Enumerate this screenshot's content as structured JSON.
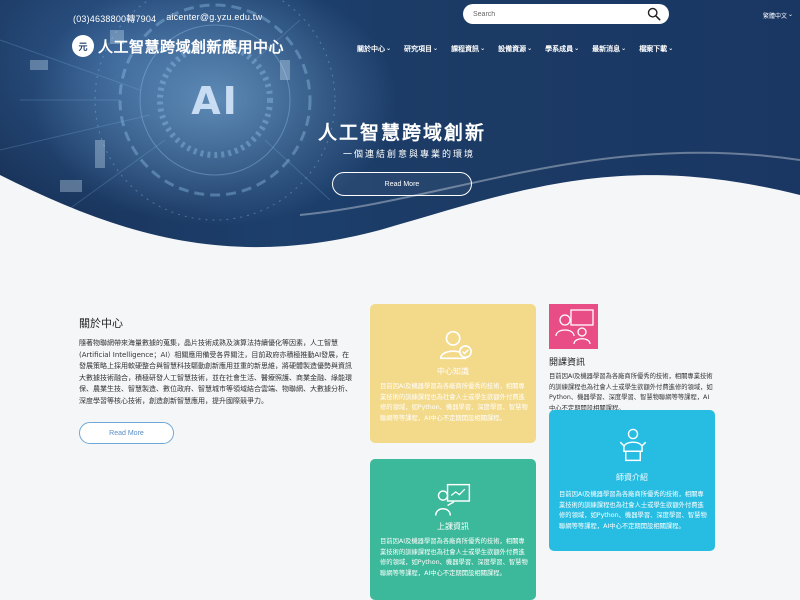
{
  "header": {
    "phone": "(03)4638800轉7904",
    "email": "aicenter@g.yzu.edu.tw",
    "logo_mark": "元",
    "logo_text": "人工智慧跨域創新應用中心",
    "search_placeholder": "Search",
    "language": "繁體中文"
  },
  "nav": {
    "items": [
      {
        "label": "關於中心"
      },
      {
        "label": "研究項目"
      },
      {
        "label": "課程資訊"
      },
      {
        "label": "設備資源"
      },
      {
        "label": "學系成員"
      },
      {
        "label": "最新消息"
      },
      {
        "label": "檔案下載"
      }
    ]
  },
  "hero": {
    "title": "人工智慧跨域創新",
    "subtitle": "一個連結創意與專業的環境",
    "button": "Read More",
    "badge": "AI"
  },
  "about": {
    "title": "關於中心",
    "text": "隨著物聯網帶來海量數據的蒐集，晶片技術成熟及演算法持續優化等因素，人工智慧(Artificial Intelligence；AI）相關應用備受各界關注，目前政府亦積極推動AI發展，在發展策略上採用軟硬整合與智慧科技驅動創新應用並重的新思維，將硬體製造優勢與資訊大數據技術融合，積極研發人工智慧技術，並在社會生活、醫療照護、商業金融、綠能環保、農業生技、智慧製造、數位政府、智慧城市等領域結合雲端、物聯網、大數據分析、深度學習等核心技術，創造創新智慧應用，提升國際競爭力。",
    "button": "Read More"
  },
  "cards": {
    "center": {
      "title": "中心知識",
      "text": "目前因AI及機器學習為各廠商所優秀的技術，相關專業技術的訓練課程也為社會人士或學生欲額外付費進修的領域，如Python、機器學習、深度學習、智慧物聯網等等課程，AI中心不定期開設相關課程。"
    },
    "open_class": {
      "title": "開課資訊",
      "text": "目前因AI及機器學習為各廠商所優秀的技術，相關專業技術的訓練課程也為社會人士或學生欲額外付費進修的領域，如Python、機器學習、深度學習、智慧物聯網等等課程，AI中心不定期開設相關課程。"
    },
    "class_info": {
      "title": "上課資訊",
      "text": "目前因AI及機器學習為各廠商所優秀的技術，相關專業技術的訓練課程也為社會人士或學生欲額外付費進修的領域，如Python、機器學習、深度學習、智慧物聯網等等課程，AI中心不定期開設相關課程。"
    },
    "teachers": {
      "title": "師資介紹",
      "text": "目前因AI及機器學習為各廠商所優秀的技術，相關專業技術的訓練課程也為社會人士或學生欲額外付費進修的領域，如Python、機器學習、深度學習、智慧物聯網等等課程，AI中心不定期開設相關課程。"
    }
  },
  "colors": {
    "hero_navy": "#1b3a64",
    "card_yellow": "#f3d98a",
    "card_green": "#3cb89a",
    "card_cyan": "#27bde3",
    "open_class_pink": "#e94d85",
    "link_blue": "#5a8dc4"
  },
  "icons": {
    "search": "search-icon",
    "center": "user-check-icon",
    "open_class": "classroom-icon",
    "class_info": "teacher-board-icon",
    "teachers": "lecturer-icon"
  }
}
